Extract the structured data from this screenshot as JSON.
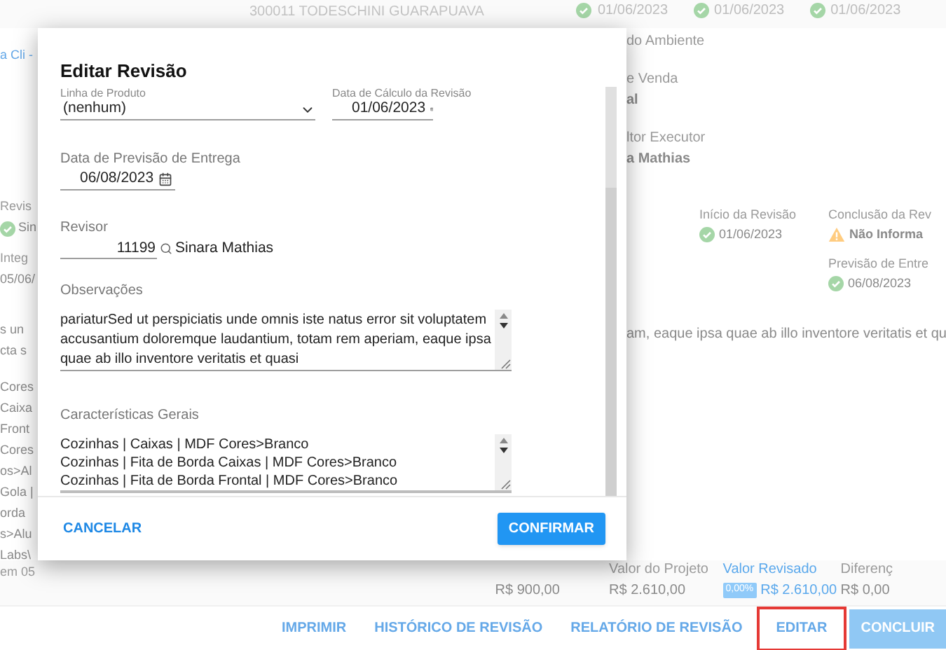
{
  "background": {
    "customer": "300011 TODESCHINI GUARAPUAVA",
    "top_dates": [
      {
        "text": "01/06/2023",
        "kind": "ok"
      },
      {
        "text": "01/06/2023",
        "kind": "ok"
      },
      {
        "text": "01/06/2023",
        "kind": "ok"
      }
    ],
    "left_groups": [
      [
        {
          "text": "a Cli -",
          "kind": "link"
        }
      ],
      [
        {
          "text": "Revis",
          "kind": "label"
        },
        {
          "text": "Sin",
          "kind": "ok"
        }
      ],
      [
        {
          "text": "Integ",
          "kind": "label"
        },
        {
          "text": "05/06/",
          "kind": "value"
        }
      ],
      [
        {
          "text": "s un",
          "kind": "value"
        },
        {
          "text": "cta s",
          "kind": "value"
        }
      ],
      [
        {
          "text": "Cores",
          "kind": "value"
        },
        {
          "text": "Caixa",
          "kind": "value"
        },
        {
          "text": "Front",
          "kind": "value"
        },
        {
          "text": "Cores",
          "kind": "value"
        },
        {
          "text": "os>Al",
          "kind": "value"
        },
        {
          "text": "Gola |",
          "kind": "value"
        },
        {
          "text": "orda",
          "kind": "value"
        },
        {
          "text": "s>Alu",
          "kind": "value"
        },
        {
          "text": "Labs\\",
          "kind": "value"
        }
      ]
    ],
    "footer_note": "em 05",
    "right_fields": [
      {
        "label": "do Ambiente"
      },
      {
        "label": "e Venda",
        "value": "al"
      },
      {
        "label": "ltor Executor",
        "value": "a Mathias"
      }
    ],
    "statuses": [
      {
        "label": "Início da Revisão",
        "value": "01/06/2023",
        "kind": "ok"
      },
      {
        "label": "Conclusão da Rev",
        "value": "Não Informa",
        "kind": "warning"
      },
      {
        "label": "Previsão de Entre",
        "value": "06/08/2023",
        "kind": "ok"
      }
    ],
    "paragraph": "am, eaque ipsa quae ab illo inventore veritatis et qu",
    "values": [
      {
        "value": "R$ 900,00",
        "highlighted": false
      },
      {
        "label": "Valor do Projeto",
        "value": "R$ 2.610,00",
        "highlighted": false
      },
      {
        "label": "Valor Revisado",
        "badge": "0,00%",
        "value": "R$ 2.610,00",
        "highlighted": true
      },
      {
        "label": "Diferenç",
        "value": "R$ 0,00",
        "highlighted": false
      }
    ],
    "actions": [
      {
        "label": "IMPRIMIR",
        "kind": "text",
        "highlighted": false
      },
      {
        "label": "HISTÓRICO DE REVISÃO",
        "kind": "text",
        "highlighted": false
      },
      {
        "label": "RELATÓRIO DE REVISÃO",
        "kind": "text",
        "highlighted": false
      },
      {
        "label": "EDITAR",
        "kind": "text",
        "highlighted": true
      },
      {
        "label": "CONCLUIR",
        "kind": "primary",
        "highlighted": false
      }
    ]
  },
  "dialog": {
    "title": "Editar Revisão",
    "product_line": {
      "label": "Linha de Produto",
      "value": "(nenhum)"
    },
    "calc_date": {
      "label": "Data de Cálculo da Revisão",
      "value": "01/06/2023"
    },
    "delivery_date": {
      "label": "Data de Previsão de Entrega",
      "value": "06/08/2023"
    },
    "reviewer": {
      "label": "Revisor",
      "code": "11199",
      "name": "Sinara Mathias"
    },
    "notes": {
      "label": "Observações",
      "value": "pariaturSed ut perspiciatis unde omnis iste natus error sit voluptatem accusantium doloremque laudantium, totam rem aperiam, eaque ipsa quae ab illo inventore veritatis et quasi"
    },
    "characteristics": {
      "label": "Características Gerais",
      "lines": [
        "Cozinhas | Caixas | MDF Cores>Branco",
        "Cozinhas | Fita de Borda Caixas | MDF Cores>Branco",
        "Cozinhas | Fita de Borda Frontal | MDF Cores>Branco"
      ]
    },
    "buttons": [
      {
        "label": "CANCELAR",
        "kind": "text"
      },
      {
        "label": "CONFIRMAR",
        "kind": "primary"
      }
    ]
  }
}
